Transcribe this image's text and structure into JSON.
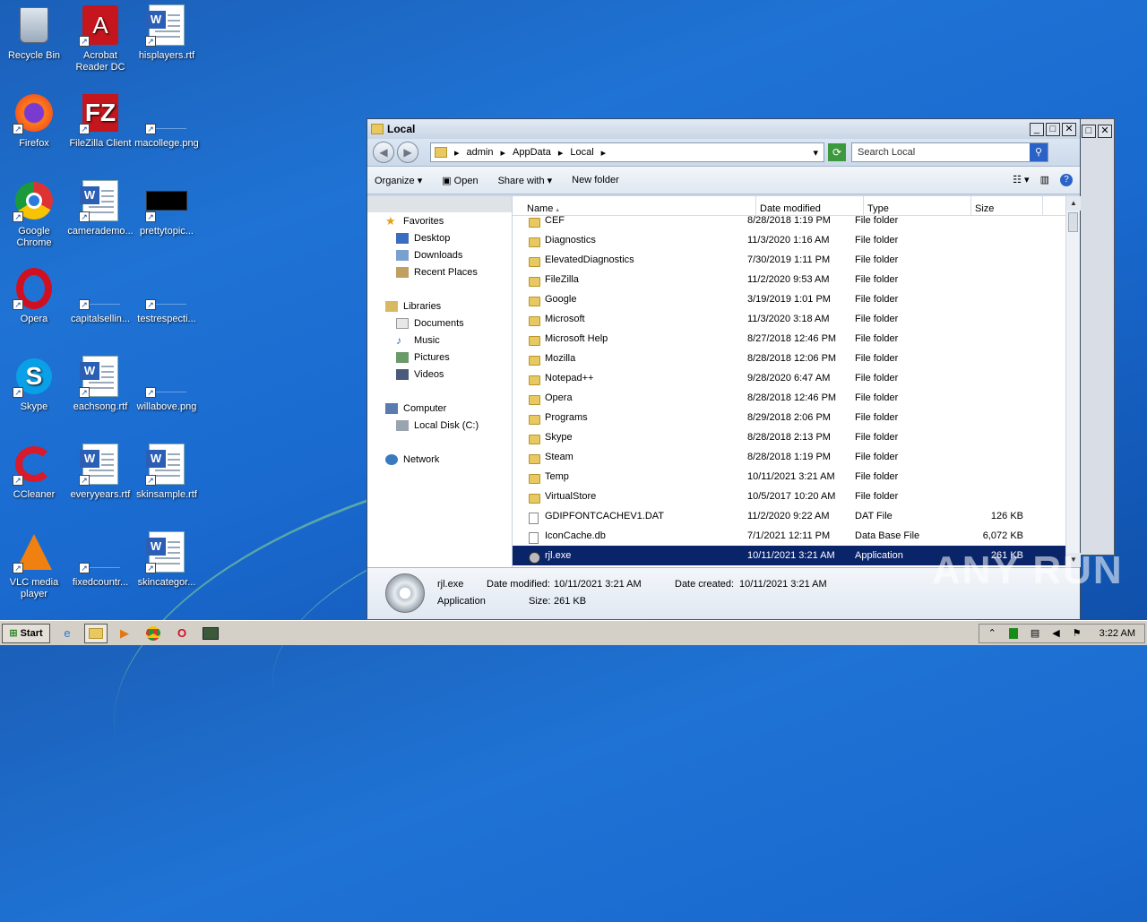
{
  "desktop": {
    "icons": [
      {
        "label": "Recycle Bin"
      },
      {
        "label": "Acrobat\nReader DC"
      },
      {
        "label": "hisplayers.rtf"
      },
      {
        "label": "Firefox"
      },
      {
        "label": "FileZilla Client"
      },
      {
        "label": "macollege.png"
      },
      {
        "label": "Google\nChrome"
      },
      {
        "label": "camerademo..."
      },
      {
        "label": "prettytopic..."
      },
      {
        "label": "Opera"
      },
      {
        "label": "capitalsellin..."
      },
      {
        "label": "testrespecti..."
      },
      {
        "label": "Skype"
      },
      {
        "label": "eachsong.rtf"
      },
      {
        "label": "willabove.png"
      },
      {
        "label": "CCleaner"
      },
      {
        "label": "everyyears.rtf"
      },
      {
        "label": "skinsample.rtf"
      },
      {
        "label": "VLC media\nplayer"
      },
      {
        "label": "fixedcountr..."
      },
      {
        "label": "skincategor..."
      }
    ]
  },
  "window": {
    "title": "Local",
    "breadcrumb": [
      "admin",
      "AppData",
      "Local"
    ],
    "search_placeholder": "Search Local",
    "toolbar": {
      "organize": "Organize",
      "open": "Open",
      "share": "Share with",
      "new_folder": "New folder"
    },
    "nav": {
      "favorites": "Favorites",
      "desktop": "Desktop",
      "downloads": "Downloads",
      "recent": "Recent Places",
      "libraries": "Libraries",
      "documents": "Documents",
      "music": "Music",
      "pictures": "Pictures",
      "videos": "Videos",
      "computer": "Computer",
      "local_disk": "Local Disk (C:)",
      "network": "Network"
    },
    "columns": {
      "name": "Name",
      "date": "Date modified",
      "type": "Type",
      "size": "Size"
    },
    "files": [
      {
        "name": "CEF",
        "date": "8/28/2018 1:19 PM",
        "type": "File folder",
        "size": "",
        "kind": "folder"
      },
      {
        "name": "Diagnostics",
        "date": "11/3/2020 1:16 AM",
        "type": "File folder",
        "size": "",
        "kind": "folder"
      },
      {
        "name": "ElevatedDiagnostics",
        "date": "7/30/2019 1:11 PM",
        "type": "File folder",
        "size": "",
        "kind": "folder"
      },
      {
        "name": "FileZilla",
        "date": "11/2/2020 9:53 AM",
        "type": "File folder",
        "size": "",
        "kind": "folder"
      },
      {
        "name": "Google",
        "date": "3/19/2019 1:01 PM",
        "type": "File folder",
        "size": "",
        "kind": "folder"
      },
      {
        "name": "Microsoft",
        "date": "11/3/2020 3:18 AM",
        "type": "File folder",
        "size": "",
        "kind": "folder"
      },
      {
        "name": "Microsoft Help",
        "date": "8/27/2018 12:46 PM",
        "type": "File folder",
        "size": "",
        "kind": "folder"
      },
      {
        "name": "Mozilla",
        "date": "8/28/2018 12:06 PM",
        "type": "File folder",
        "size": "",
        "kind": "folder"
      },
      {
        "name": "Notepad++",
        "date": "9/28/2020 6:47 AM",
        "type": "File folder",
        "size": "",
        "kind": "folder"
      },
      {
        "name": "Opera",
        "date": "8/28/2018 12:46 PM",
        "type": "File folder",
        "size": "",
        "kind": "folder"
      },
      {
        "name": "Programs",
        "date": "8/29/2018 2:06 PM",
        "type": "File folder",
        "size": "",
        "kind": "folder"
      },
      {
        "name": "Skype",
        "date": "8/28/2018 2:13 PM",
        "type": "File folder",
        "size": "",
        "kind": "folder"
      },
      {
        "name": "Steam",
        "date": "8/28/2018 1:19 PM",
        "type": "File folder",
        "size": "",
        "kind": "folder"
      },
      {
        "name": "Temp",
        "date": "10/11/2021 3:21 AM",
        "type": "File folder",
        "size": "",
        "kind": "folder"
      },
      {
        "name": "VirtualStore",
        "date": "10/5/2017 10:20 AM",
        "type": "File folder",
        "size": "",
        "kind": "folder"
      },
      {
        "name": "GDIPFONTCACHEV1.DAT",
        "date": "11/2/2020 9:22 AM",
        "type": "DAT File",
        "size": "126 KB",
        "kind": "file"
      },
      {
        "name": "IconCache.db",
        "date": "7/1/2021 12:11 PM",
        "type": "Data Base File",
        "size": "6,072 KB",
        "kind": "file"
      },
      {
        "name": "rjl.exe",
        "date": "10/11/2021 3:21 AM",
        "type": "Application",
        "size": "261 KB",
        "kind": "app",
        "selected": true
      }
    ],
    "details": {
      "name": "rjl.exe",
      "type": "Application",
      "modified_label": "Date modified:",
      "modified_value": "10/11/2021 3:21 AM",
      "created_label": "Date created:",
      "created_value": "10/11/2021 3:21 AM",
      "size_label": "Size:",
      "size_value": "261 KB"
    }
  },
  "taskbar": {
    "start": "Start",
    "clock": "3:22 AM"
  },
  "watermark": "ANY RUN"
}
